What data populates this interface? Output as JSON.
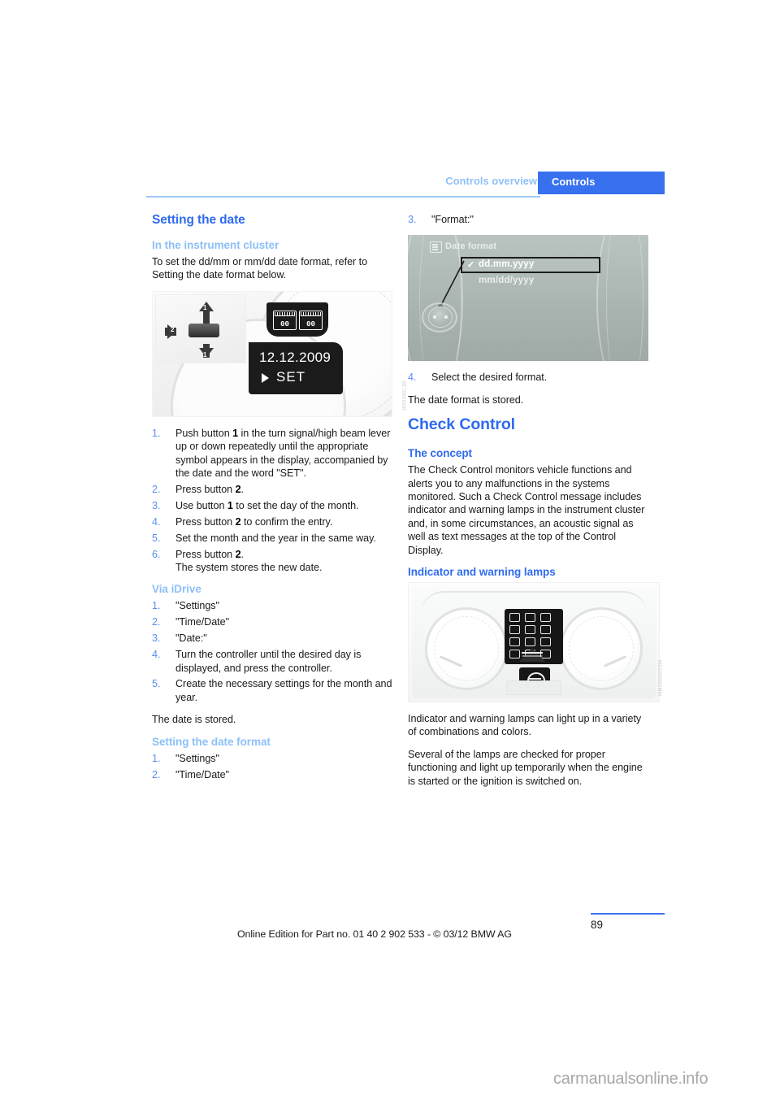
{
  "header": {
    "breadcrumb": "Controls overview",
    "tab": "Controls"
  },
  "left_column": {
    "section_title": "Setting the date",
    "sub1_title": "In the instrument cluster",
    "sub1_intro": "To set the dd/mm or mm/dd date format, refer to Setting the date format below.",
    "figure1": {
      "caption_watermark": "SE70000GR",
      "lcd_date": "12.12.2009",
      "lcd_set": "SET",
      "lcd_digits_a": "00",
      "lcd_digits_b": "00",
      "callout_1_top": "1",
      "callout_1_bottom": "1",
      "callout_2": "2"
    },
    "steps": [
      {
        "num": "1.",
        "html": "Push button <b>1</b> in the turn signal/high beam lever up or down repeatedly until the appropriate symbol appears in the display, accompanied by the date and the word \"SET\"."
      },
      {
        "num": "2.",
        "html": "Press button <b>2</b>."
      },
      {
        "num": "3.",
        "html": "Use button <b>1</b> to set the day of the month."
      },
      {
        "num": "4.",
        "html": "Press button <b>2</b> to confirm the entry."
      },
      {
        "num": "5.",
        "html": "Set the month and the year in the same way."
      },
      {
        "num": "6.",
        "html": "Press button <b>2</b>.<br>The system stores the new date."
      }
    ],
    "sub2_title": "Via iDrive",
    "steps2": [
      {
        "num": "1.",
        "html": "\"Settings\""
      },
      {
        "num": "2.",
        "html": "\"Time/Date\""
      },
      {
        "num": "3.",
        "html": "\"Date:\""
      },
      {
        "num": "4.",
        "html": "Turn the controller until the desired day is displayed, and press the controller."
      },
      {
        "num": "5.",
        "html": "Create the necessary settings for the month and year."
      }
    ],
    "stored_note": "The date is stored.",
    "sub3_title": "Setting the date format",
    "steps3": [
      {
        "num": "1.",
        "html": "\"Settings\""
      },
      {
        "num": "2.",
        "html": "\"Time/Date\""
      }
    ]
  },
  "right_column": {
    "step3": {
      "num": "3.",
      "html": "\"Format:\""
    },
    "figure2": {
      "menu_title": "Date format",
      "option_selected": "dd.mm.yyyy",
      "option_other": "mm/dd/yyyy",
      "check_glyph": "✓",
      "icon_name": "date-format-icon"
    },
    "step4": {
      "num": "4.",
      "html": "Select the desired format."
    },
    "stored_note": "The date format is stored.",
    "section_title": "Check Control",
    "sub1_title": "The concept",
    "sub1_text": "The Check Control monitors vehicle functions and alerts you to any malfunctions in the systems monitored. Such a Check Control message includes indicator and warning lamps in the instrument cluster and, in some circumstances, an acoustic signal as well as text messages at the top of the Control Display.",
    "sub2_title": "Indicator and warning lamps",
    "figure3": {
      "caption_watermark": "MCD00000MM"
    },
    "para1": "Indicator and warning lamps can light up in a variety of combinations and colors.",
    "para2": "Several of the lamps are checked for proper functioning and light up temporarily when the engine is started or the ignition is switched on."
  },
  "footer": {
    "page_number": "89",
    "note": "Online Edition for Part no. 01 40 2 902 533 - © 03/12 BMW AG",
    "site_watermark": "carmanualsonline.info"
  },
  "colors": {
    "accent_blue": "#2f6bee",
    "tab_blue": "#3771f0",
    "light_blue": "#8dc0f7",
    "rule_blue": "#9ec9f7",
    "step_num_blue": "#5a8df2",
    "body_text": "#1a1a1a",
    "watermark_gray": "#a7a7a7"
  }
}
